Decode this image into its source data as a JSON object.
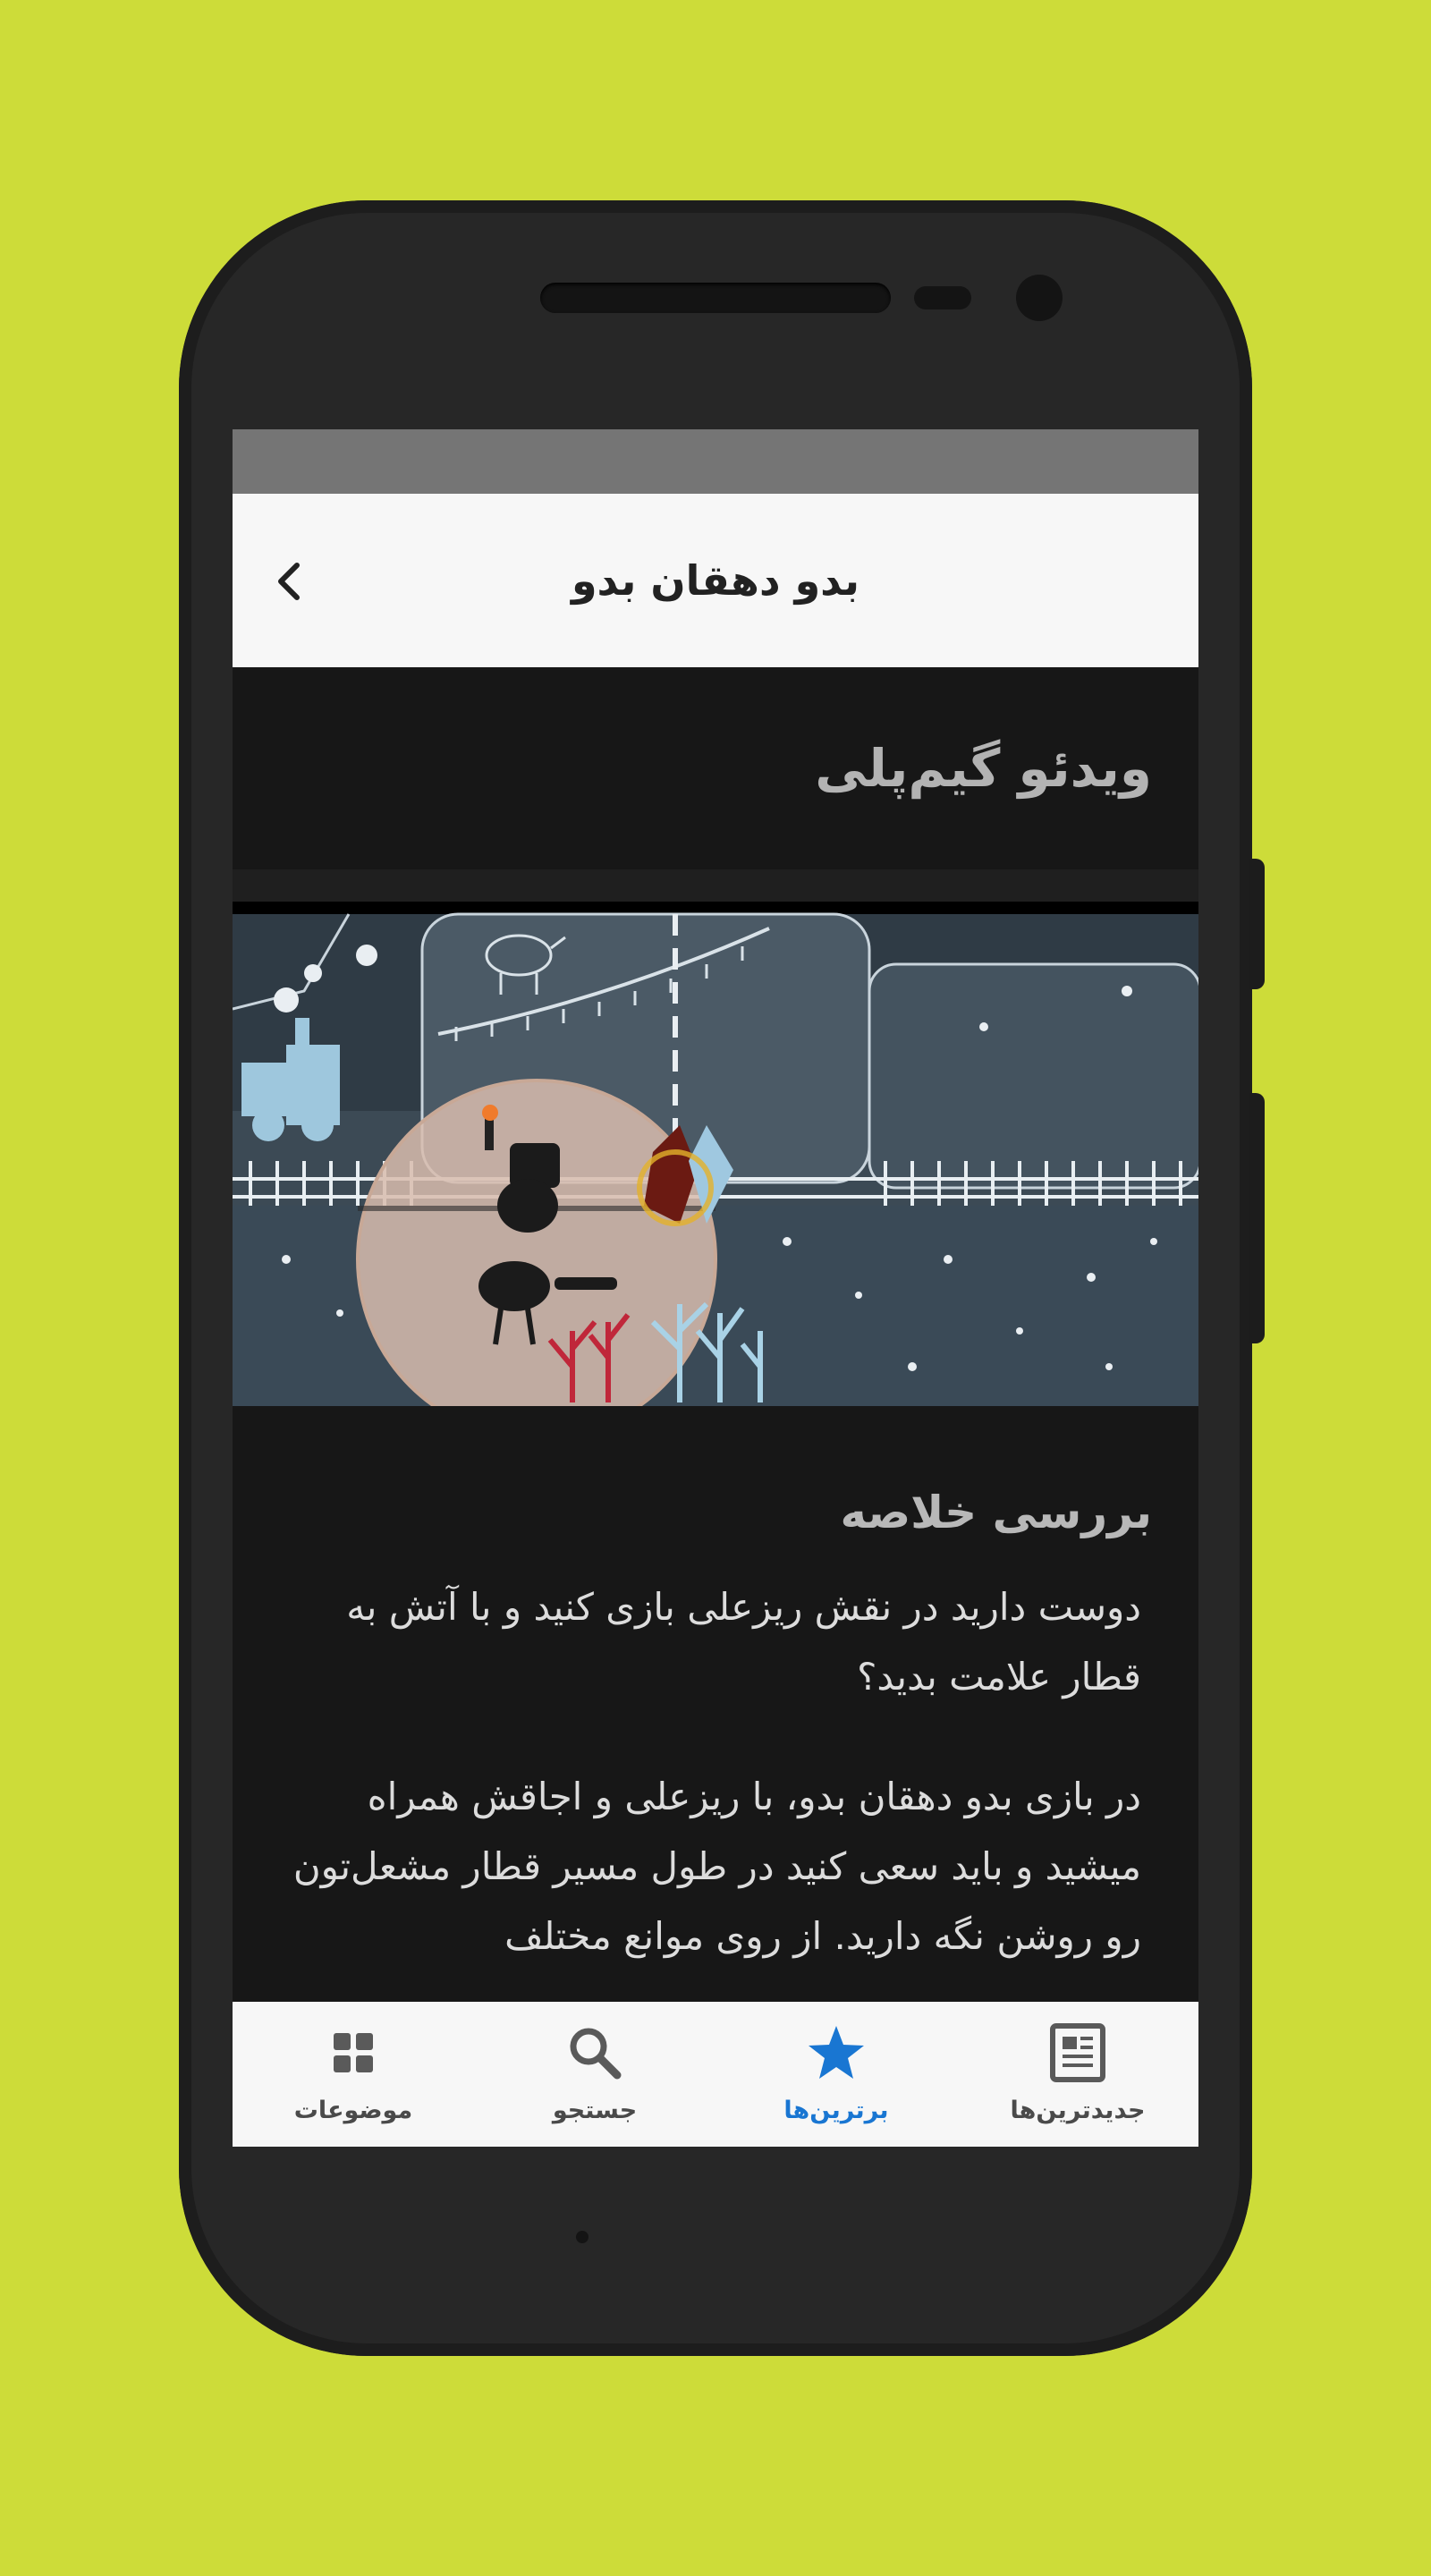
{
  "app": {
    "title": "بدو دهقان بدو"
  },
  "section": {
    "title": "ویدئو گیم‌پلی"
  },
  "review": {
    "heading": "بررسی خلاصه",
    "paragraph_1": "دوست دارید در نقش ریزعلی بازی کنید و با آتش به قطار علامت بدید؟",
    "paragraph_2": "در بازی بدو دهقان بدو، با ریزعلی و اجاقش همراه میشید و باید سعی کنید در طول مسیر قطار مشعل‌تون رو روشن نگه دارید. از روی موانع مختلف"
  },
  "bottom_nav": {
    "items": [
      {
        "label": "جدیدترین‌ها",
        "icon": "newspaper-icon",
        "active": false
      },
      {
        "label": "برترین‌ها",
        "icon": "star-icon",
        "active": true
      },
      {
        "label": "جستجو",
        "icon": "search-icon",
        "active": false
      },
      {
        "label": "موضوعات",
        "icon": "grid-icon",
        "active": false
      }
    ]
  },
  "colors": {
    "background": "#cddc39",
    "accent": "#1976d2",
    "screen_dark": "#171717",
    "app_bar": "#f7f7f7"
  }
}
